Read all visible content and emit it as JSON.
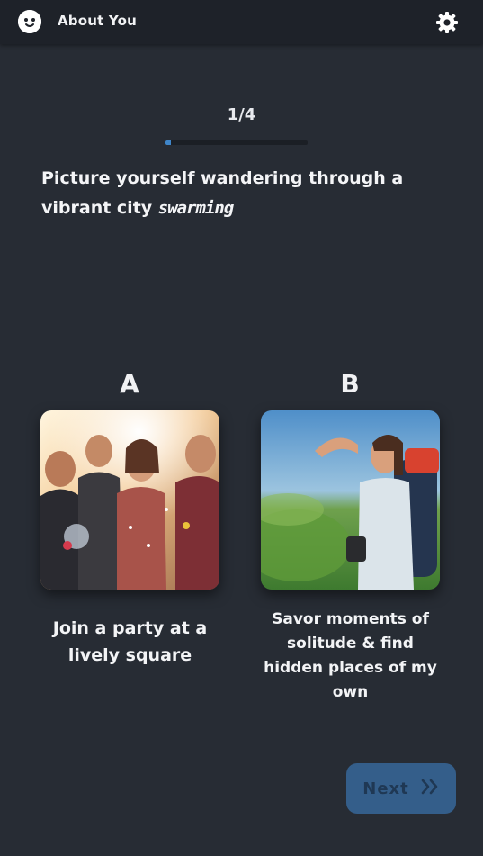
{
  "header": {
    "title": "About You",
    "logo_icon": "smiley-face-icon",
    "settings_icon": "gear-icon"
  },
  "progress": {
    "text": "1/4",
    "fraction": 0.04
  },
  "question": {
    "text_before": "Picture yourself wandering through a vibrant city ",
    "highlight": "swarming"
  },
  "options": [
    {
      "letter": "A",
      "label": "Join a party at a lively square"
    },
    {
      "letter": "B",
      "label": "Savor moments of solitude & find hidden places of my own"
    }
  ],
  "next": {
    "label": "Next",
    "icon": "double-chevron-right-icon"
  },
  "colors": {
    "background": "#272c34",
    "topbar": "#1e2229",
    "accent": "#3f86c9",
    "button": "#345e8a"
  }
}
